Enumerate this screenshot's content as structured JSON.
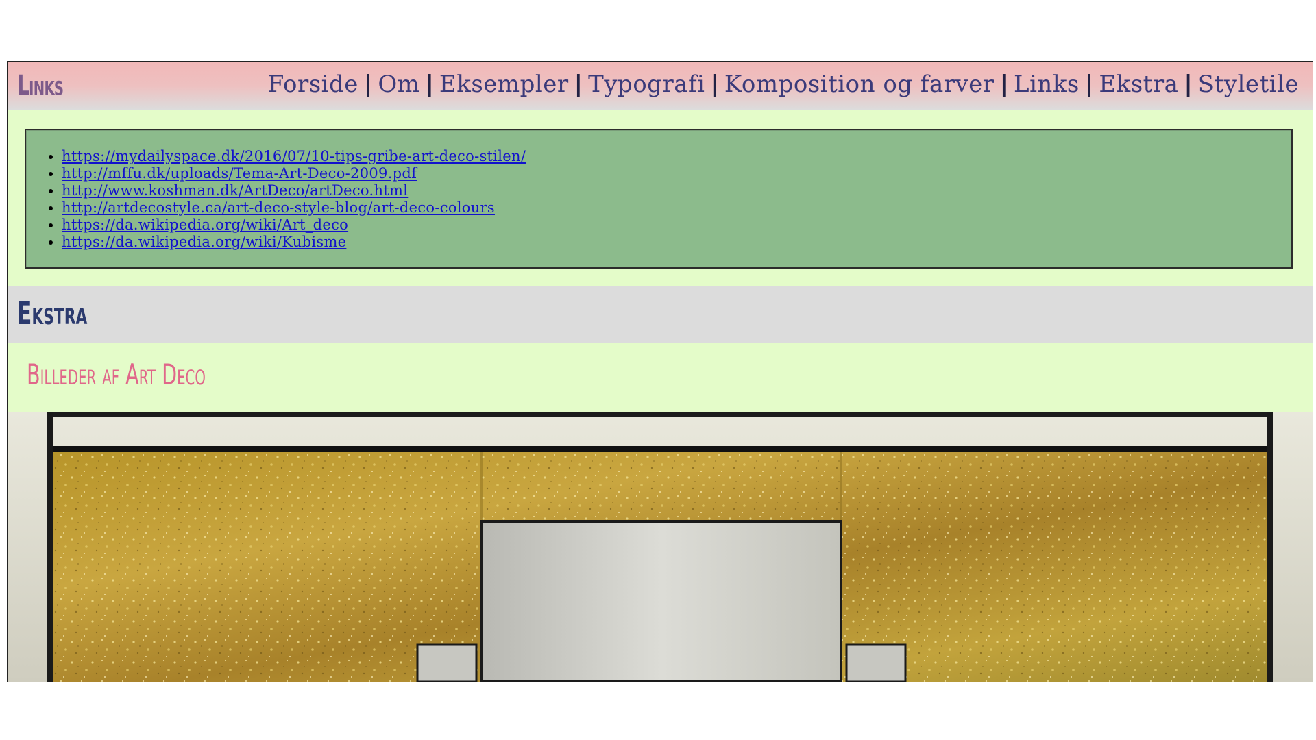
{
  "header": {
    "title": "Links",
    "nav": [
      {
        "label": "Forside"
      },
      {
        "label": "Om"
      },
      {
        "label": "Eksempler"
      },
      {
        "label": "Typografi"
      },
      {
        "label": "Komposition og farver"
      },
      {
        "label": "Links"
      },
      {
        "label": "Ekstra"
      },
      {
        "label": "Styletile"
      }
    ],
    "separator": "|"
  },
  "links": [
    "https://mydailyspace.dk/2016/07/10-tips-gribe-art-deco-stilen/",
    "http://mffu.dk/uploads/Tema-Art-Deco-2009.pdf",
    "http://www.koshman.dk/ArtDeco/artDeco.html",
    "http://artdecostyle.ca/art-deco-style-blog/art-deco-colours",
    "https://da.wikipedia.org/wiki/Art_deco",
    "https://da.wikipedia.org/wiki/Kubisme"
  ],
  "section": {
    "title": "Ekstra",
    "subtitle": "Billeder af Art Deco"
  },
  "colors": {
    "page_bg": "#e4fcc9",
    "links_box_bg": "#8cbb8c",
    "link": "#1212cc",
    "nav_link": "#3a3a7a",
    "section_title": "#2b3a6e",
    "subtitle": "#e0678a",
    "header_title": "#7d5a8a"
  }
}
